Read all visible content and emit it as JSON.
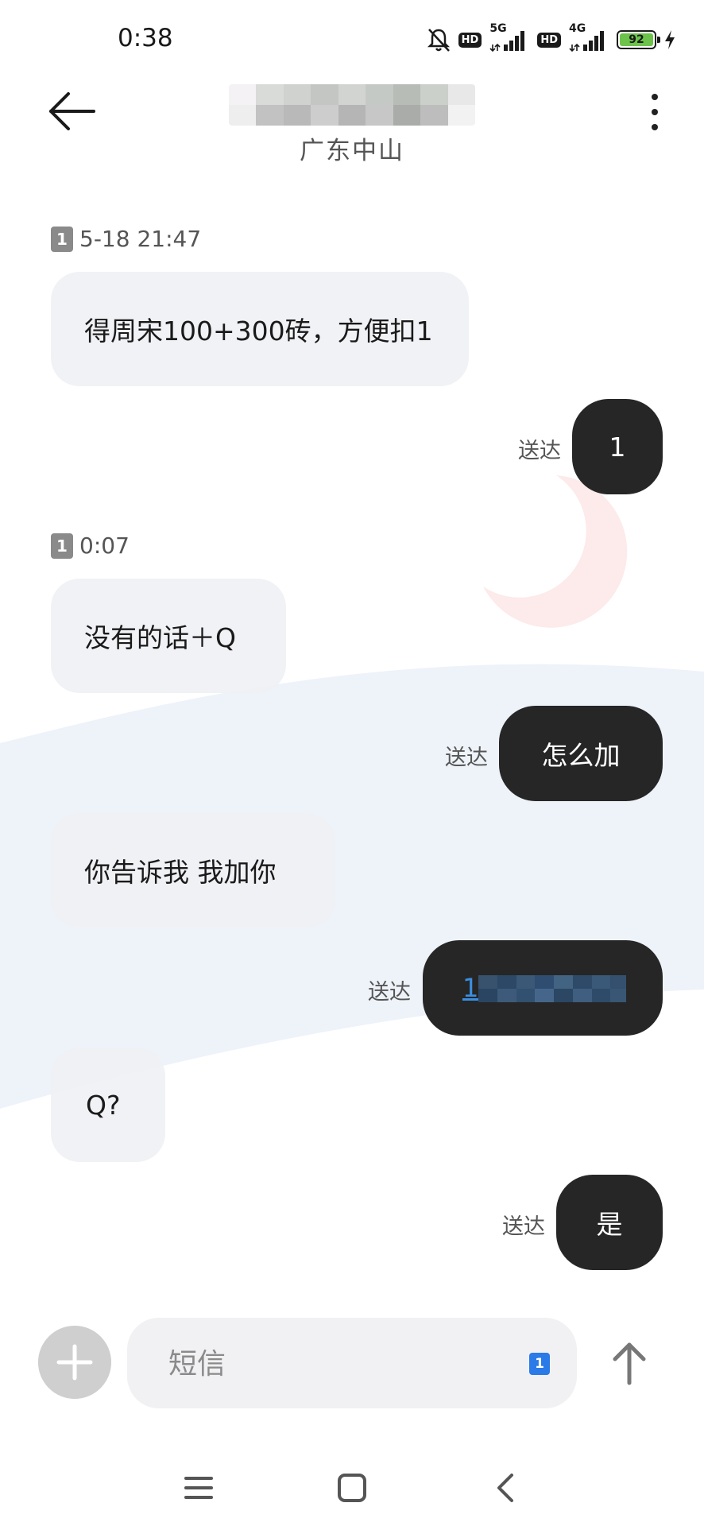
{
  "status_bar": {
    "time": "0:38",
    "hd_label": "HD",
    "network_1": "5G",
    "network_2": "4G",
    "battery_level": "92",
    "icons": [
      "bell-off-icon",
      "hd-icon",
      "signal-5g-icon",
      "hd-icon",
      "signal-4g-icon",
      "battery-icon",
      "charging-icon"
    ]
  },
  "header": {
    "contact_location": "广东中山",
    "icons": [
      "back-arrow-icon",
      "more-vert-icon"
    ]
  },
  "conversation": {
    "messages": [
      {
        "type": "timestamp",
        "sim": "1",
        "time": "5-18 21:47"
      },
      {
        "type": "incoming",
        "text": "得周宋100+300砖，方便扣1"
      },
      {
        "type": "outgoing",
        "text": "1",
        "status": "送达"
      },
      {
        "type": "timestamp",
        "sim": "1",
        "time": "0:07"
      },
      {
        "type": "incoming",
        "text": "没有的话＋Q"
      },
      {
        "type": "outgoing",
        "text": "怎么加",
        "status": "送达"
      },
      {
        "type": "incoming",
        "text": "你告诉我  我加你"
      },
      {
        "type": "outgoing",
        "text": "1",
        "status": "送达"
      },
      {
        "type": "incoming",
        "text": "Q?"
      },
      {
        "type": "outgoing",
        "text": "是",
        "status": "送达"
      }
    ]
  },
  "composer": {
    "placeholder": "短信",
    "sim_badge": "1",
    "icons": [
      "add-icon",
      "arrow-up-icon"
    ]
  },
  "nav_bar": {
    "icons": [
      "menu-icon",
      "home-icon",
      "back-icon"
    ]
  },
  "colors": {
    "outgoing_bubble": "#262626",
    "incoming_bubble": "#f0f1f4",
    "link": "#3a8fe0",
    "sim_chip": "#2a7ae8",
    "battery_fill": "#6cc24a"
  }
}
